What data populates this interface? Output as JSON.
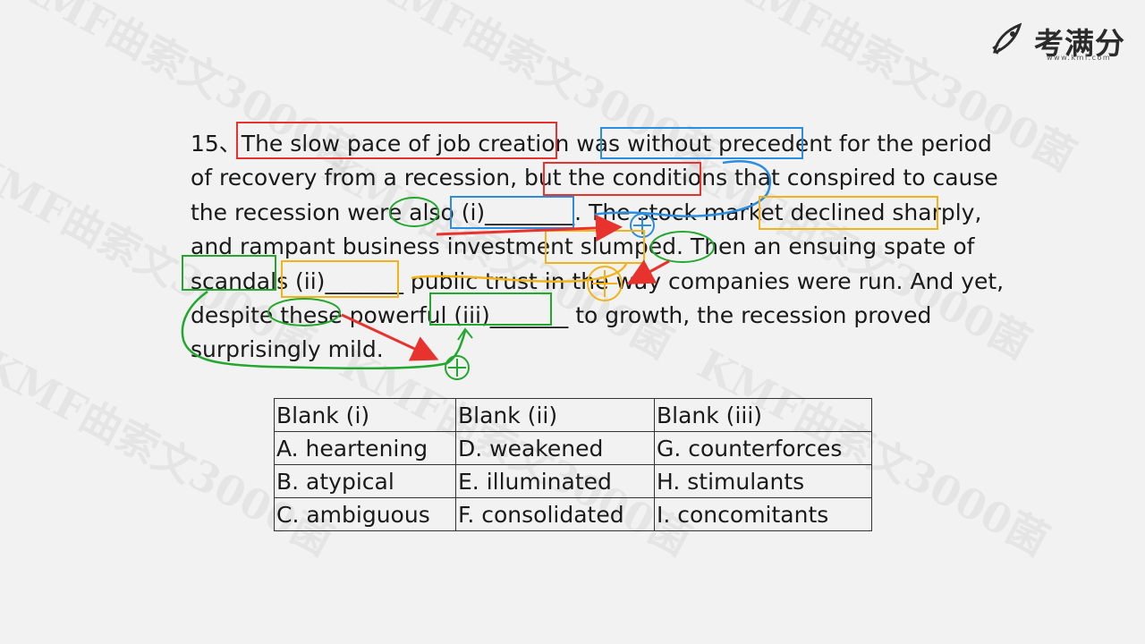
{
  "logo": {
    "text": "考满分",
    "url": "www.kmf.com"
  },
  "watermark": "KMF曲索文3000菌",
  "question": {
    "lines": [
      "15、The slow pace of job creation was without precedent for the period",
      "of recovery from a recession, but the conditions that conspired to cause",
      "the recession were also (i)________. The stock market declined sharply,",
      "and rampant business investment slumped. Then an ensuing spate of",
      "scandals (ii)_______ public trust in the way companies were run. And yet,",
      "despite these powerful (iii)_______ to growth, the recession proved",
      "surprisingly mild."
    ]
  },
  "choices_table": {
    "headers": [
      "Blank (i)",
      "Blank (ii)",
      "Blank (iii)"
    ],
    "rows": [
      [
        "A. heartening",
        "D. weakened",
        "G. counterforces"
      ],
      [
        "B. atypical",
        "E. illuminated",
        "H. stimulants"
      ],
      [
        "C. ambiguous",
        "F. consolidated",
        "I. concomitants"
      ]
    ]
  },
  "colors": {
    "red": "#e8322d",
    "blue": "#2a8de0",
    "orange": "#f2b318",
    "green": "#22a82e"
  }
}
